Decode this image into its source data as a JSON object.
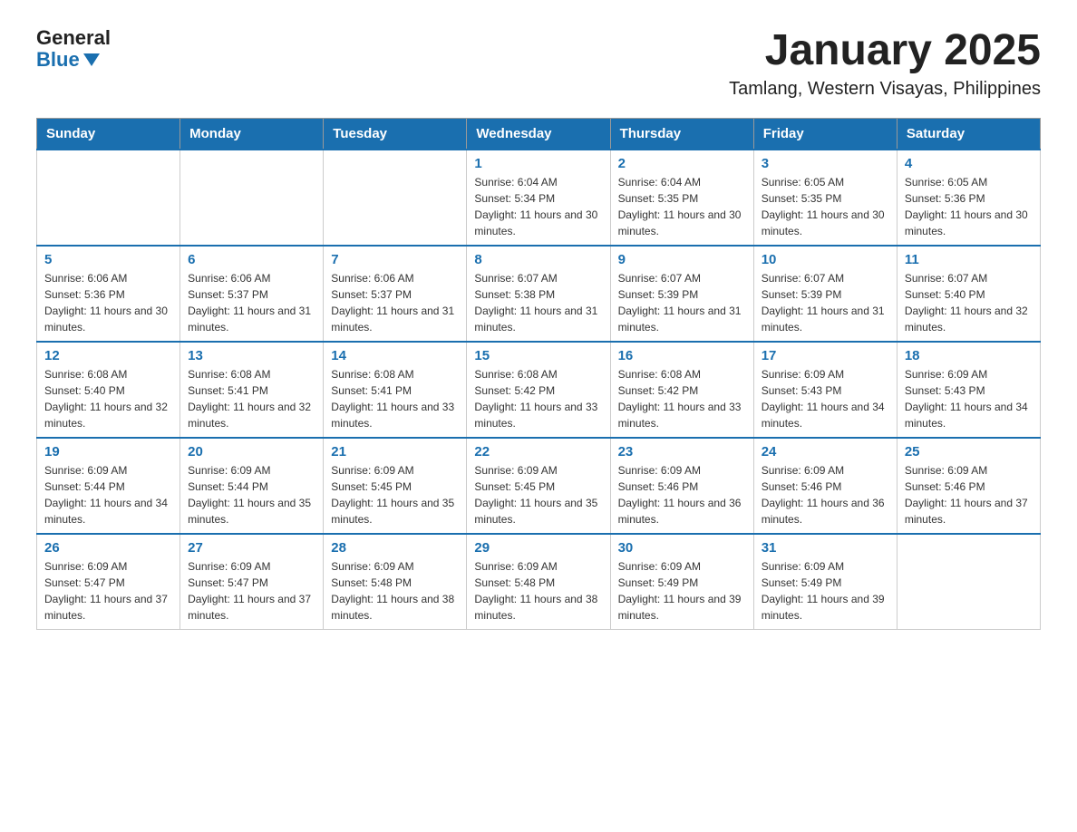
{
  "header": {
    "logo_general": "General",
    "logo_blue": "Blue",
    "title": "January 2025",
    "subtitle": "Tamlang, Western Visayas, Philippines"
  },
  "days_of_week": [
    "Sunday",
    "Monday",
    "Tuesday",
    "Wednesday",
    "Thursday",
    "Friday",
    "Saturday"
  ],
  "weeks": [
    [
      null,
      null,
      null,
      {
        "num": "1",
        "sunrise": "6:04 AM",
        "sunset": "5:34 PM",
        "daylight": "11 hours and 30 minutes."
      },
      {
        "num": "2",
        "sunrise": "6:04 AM",
        "sunset": "5:35 PM",
        "daylight": "11 hours and 30 minutes."
      },
      {
        "num": "3",
        "sunrise": "6:05 AM",
        "sunset": "5:35 PM",
        "daylight": "11 hours and 30 minutes."
      },
      {
        "num": "4",
        "sunrise": "6:05 AM",
        "sunset": "5:36 PM",
        "daylight": "11 hours and 30 minutes."
      }
    ],
    [
      {
        "num": "5",
        "sunrise": "6:06 AM",
        "sunset": "5:36 PM",
        "daylight": "11 hours and 30 minutes."
      },
      {
        "num": "6",
        "sunrise": "6:06 AM",
        "sunset": "5:37 PM",
        "daylight": "11 hours and 31 minutes."
      },
      {
        "num": "7",
        "sunrise": "6:06 AM",
        "sunset": "5:37 PM",
        "daylight": "11 hours and 31 minutes."
      },
      {
        "num": "8",
        "sunrise": "6:07 AM",
        "sunset": "5:38 PM",
        "daylight": "11 hours and 31 minutes."
      },
      {
        "num": "9",
        "sunrise": "6:07 AM",
        "sunset": "5:39 PM",
        "daylight": "11 hours and 31 minutes."
      },
      {
        "num": "10",
        "sunrise": "6:07 AM",
        "sunset": "5:39 PM",
        "daylight": "11 hours and 31 minutes."
      },
      {
        "num": "11",
        "sunrise": "6:07 AM",
        "sunset": "5:40 PM",
        "daylight": "11 hours and 32 minutes."
      }
    ],
    [
      {
        "num": "12",
        "sunrise": "6:08 AM",
        "sunset": "5:40 PM",
        "daylight": "11 hours and 32 minutes."
      },
      {
        "num": "13",
        "sunrise": "6:08 AM",
        "sunset": "5:41 PM",
        "daylight": "11 hours and 32 minutes."
      },
      {
        "num": "14",
        "sunrise": "6:08 AM",
        "sunset": "5:41 PM",
        "daylight": "11 hours and 33 minutes."
      },
      {
        "num": "15",
        "sunrise": "6:08 AM",
        "sunset": "5:42 PM",
        "daylight": "11 hours and 33 minutes."
      },
      {
        "num": "16",
        "sunrise": "6:08 AM",
        "sunset": "5:42 PM",
        "daylight": "11 hours and 33 minutes."
      },
      {
        "num": "17",
        "sunrise": "6:09 AM",
        "sunset": "5:43 PM",
        "daylight": "11 hours and 34 minutes."
      },
      {
        "num": "18",
        "sunrise": "6:09 AM",
        "sunset": "5:43 PM",
        "daylight": "11 hours and 34 minutes."
      }
    ],
    [
      {
        "num": "19",
        "sunrise": "6:09 AM",
        "sunset": "5:44 PM",
        "daylight": "11 hours and 34 minutes."
      },
      {
        "num": "20",
        "sunrise": "6:09 AM",
        "sunset": "5:44 PM",
        "daylight": "11 hours and 35 minutes."
      },
      {
        "num": "21",
        "sunrise": "6:09 AM",
        "sunset": "5:45 PM",
        "daylight": "11 hours and 35 minutes."
      },
      {
        "num": "22",
        "sunrise": "6:09 AM",
        "sunset": "5:45 PM",
        "daylight": "11 hours and 35 minutes."
      },
      {
        "num": "23",
        "sunrise": "6:09 AM",
        "sunset": "5:46 PM",
        "daylight": "11 hours and 36 minutes."
      },
      {
        "num": "24",
        "sunrise": "6:09 AM",
        "sunset": "5:46 PM",
        "daylight": "11 hours and 36 minutes."
      },
      {
        "num": "25",
        "sunrise": "6:09 AM",
        "sunset": "5:46 PM",
        "daylight": "11 hours and 37 minutes."
      }
    ],
    [
      {
        "num": "26",
        "sunrise": "6:09 AM",
        "sunset": "5:47 PM",
        "daylight": "11 hours and 37 minutes."
      },
      {
        "num": "27",
        "sunrise": "6:09 AM",
        "sunset": "5:47 PM",
        "daylight": "11 hours and 37 minutes."
      },
      {
        "num": "28",
        "sunrise": "6:09 AM",
        "sunset": "5:48 PM",
        "daylight": "11 hours and 38 minutes."
      },
      {
        "num": "29",
        "sunrise": "6:09 AM",
        "sunset": "5:48 PM",
        "daylight": "11 hours and 38 minutes."
      },
      {
        "num": "30",
        "sunrise": "6:09 AM",
        "sunset": "5:49 PM",
        "daylight": "11 hours and 39 minutes."
      },
      {
        "num": "31",
        "sunrise": "6:09 AM",
        "sunset": "5:49 PM",
        "daylight": "11 hours and 39 minutes."
      },
      null
    ]
  ]
}
